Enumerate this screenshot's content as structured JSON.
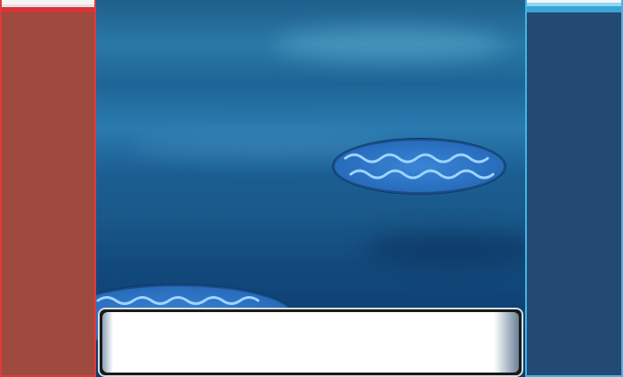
{
  "screen": {
    "type": "battle-scene",
    "environment": "water"
  },
  "colors": {
    "player_panel": "#9e4a3e",
    "player_panel_accent": "#e03a3a",
    "opponent_panel": "#224a72",
    "opponent_panel_accent": "#3fb6e6",
    "water_platform": "#2a6fc0",
    "wave_highlight": "#9fd4ff"
  },
  "message_box": {
    "text": ""
  },
  "icons": {
    "platform_pattern": "wave-pattern-icon"
  }
}
